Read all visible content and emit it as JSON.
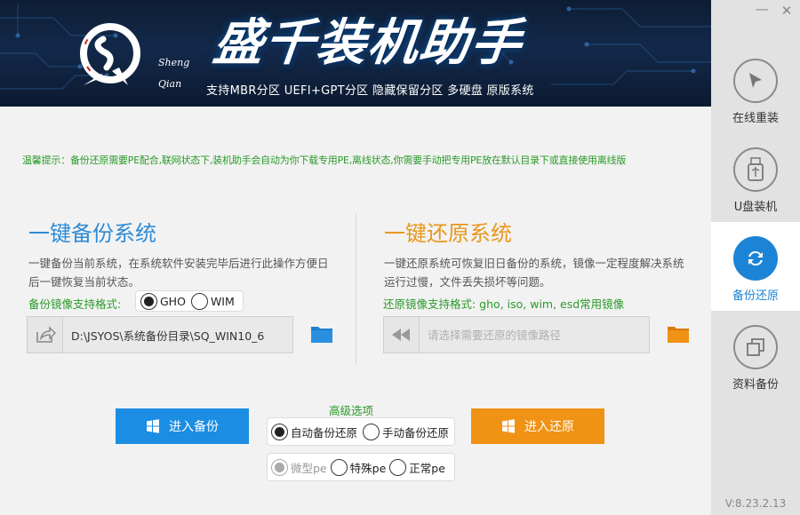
{
  "header": {
    "title": "盛千装机助手",
    "logo_text_1": "Sheng",
    "logo_text_2": "Qian",
    "subtitle": "支持MBR分区 UEFI+GPT分区 隐藏保留分区 多硬盘   原版系统"
  },
  "window": {
    "minimize_label": "—",
    "close_label": "✕"
  },
  "sidebar": {
    "items": [
      {
        "label": "在线重装",
        "icon": "cursor-icon"
      },
      {
        "label": "U盘装机",
        "icon": "usb-icon"
      },
      {
        "label": "备份还原",
        "icon": "sync-icon",
        "active": true
      },
      {
        "label": "资料备份",
        "icon": "copy-icon"
      }
    ],
    "version": "V:8.23.2.13"
  },
  "tip": "温馨提示：备份还原需要PE配合,联网状态下,装机助手会自动为你下载专用PE,离线状态,你需要手动把专用PE放在默认目录下或直接使用离线版",
  "backup": {
    "title": "一键备份系统",
    "desc": "一键备份当前系统，在系统软件安装完毕后进行此操作方便日后一键恢复当前状态。",
    "format_label": "备份镜像支持格式:",
    "formats": [
      "GHO",
      "WIM"
    ],
    "selected_format": "GHO",
    "path_value": "D:\\JSYOS\\系统备份目录\\SQ_WIN10_6",
    "button_label": "进入备份"
  },
  "restore": {
    "title": "一键还原系统",
    "desc": "一键还原系统可恢复旧日备份的系统，镜像一定程度解决系统运行过慢，文件丢失损坏等问题。",
    "format_label": "还原镜像支持格式: gho, iso, wim, esd常用镜像",
    "path_placeholder": "请选择需要还原的镜像路径",
    "button_label": "进入还原"
  },
  "advanced": {
    "label": "高级选项",
    "modes": [
      "自动备份还原",
      "手动备份还原"
    ],
    "selected_mode": "自动备份还原",
    "pe_types": [
      "微型pe",
      "特殊pe",
      "正常pe"
    ],
    "selected_pe": "微型pe"
  },
  "colors": {
    "accent_blue": "#1b8de3",
    "accent_orange": "#f09214",
    "tip_green": "#2a9a2a"
  }
}
